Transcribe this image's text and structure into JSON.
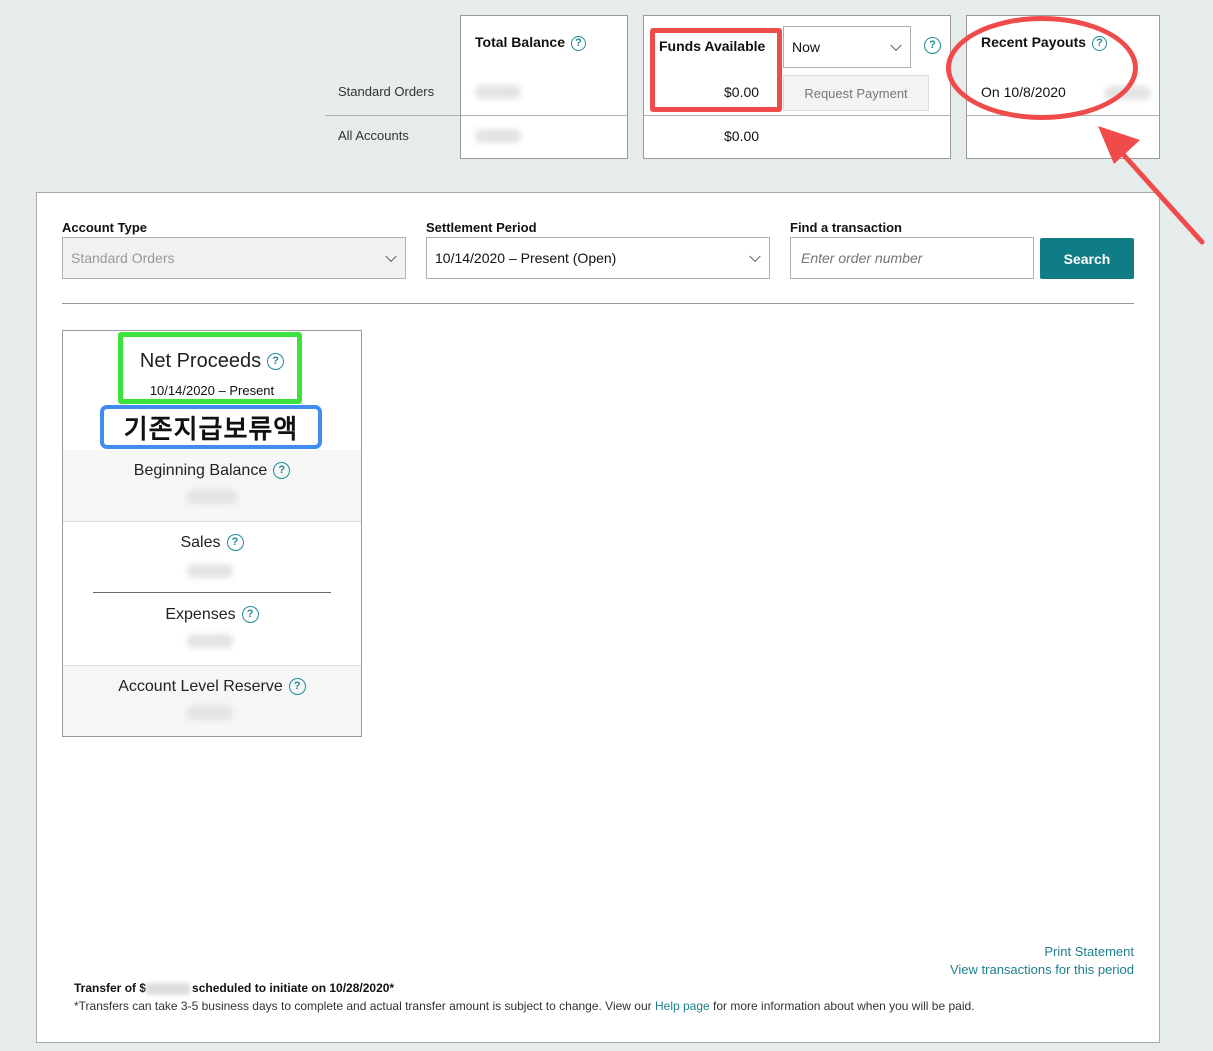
{
  "summary": {
    "total_balance_header": "Total Balance",
    "funds_available_header": "Funds Available",
    "period_select_value": "Now",
    "recent_payouts_header": "Recent Payouts",
    "rows": [
      {
        "label": "Standard Orders",
        "funds_available": "$0.00",
        "recent_payout": "On 10/8/2020"
      },
      {
        "label": "All Accounts",
        "funds_available": "$0.00"
      }
    ],
    "request_payment_label": "Request Payment"
  },
  "filters": {
    "account_type_label": "Account Type",
    "account_type_value": "Standard Orders",
    "settlement_period_label": "Settlement Period",
    "settlement_period_value": "10/14/2020 – Present (Open)",
    "find_label": "Find a transaction",
    "find_placeholder": "Enter order number",
    "search_label": "Search"
  },
  "net_proceeds": {
    "title": "Net Proceeds",
    "date_range": "10/14/2020 – Present",
    "annotation": "기존지급보류액",
    "beginning_balance": "Beginning Balance",
    "sales": "Sales",
    "expenses": "Expenses",
    "reserve": "Account Level Reserve"
  },
  "footer": {
    "print_statement": "Print Statement",
    "view_transactions": "View transactions for this period",
    "transfer_prefix": "Transfer of $",
    "transfer_suffix": "scheduled to initiate on 10/28/2020*",
    "note_before": "*Transfers can take 3-5 business days to complete and actual transfer amount is subject to change. View our ",
    "help_link": "Help page",
    "note_after": " for more information about when you will be paid."
  },
  "colors": {
    "accent": "#1d8a95",
    "button": "#107c86",
    "annotation_red": "#f04b4b",
    "annotation_green": "#3de33d",
    "annotation_blue": "#3f8cf3"
  }
}
